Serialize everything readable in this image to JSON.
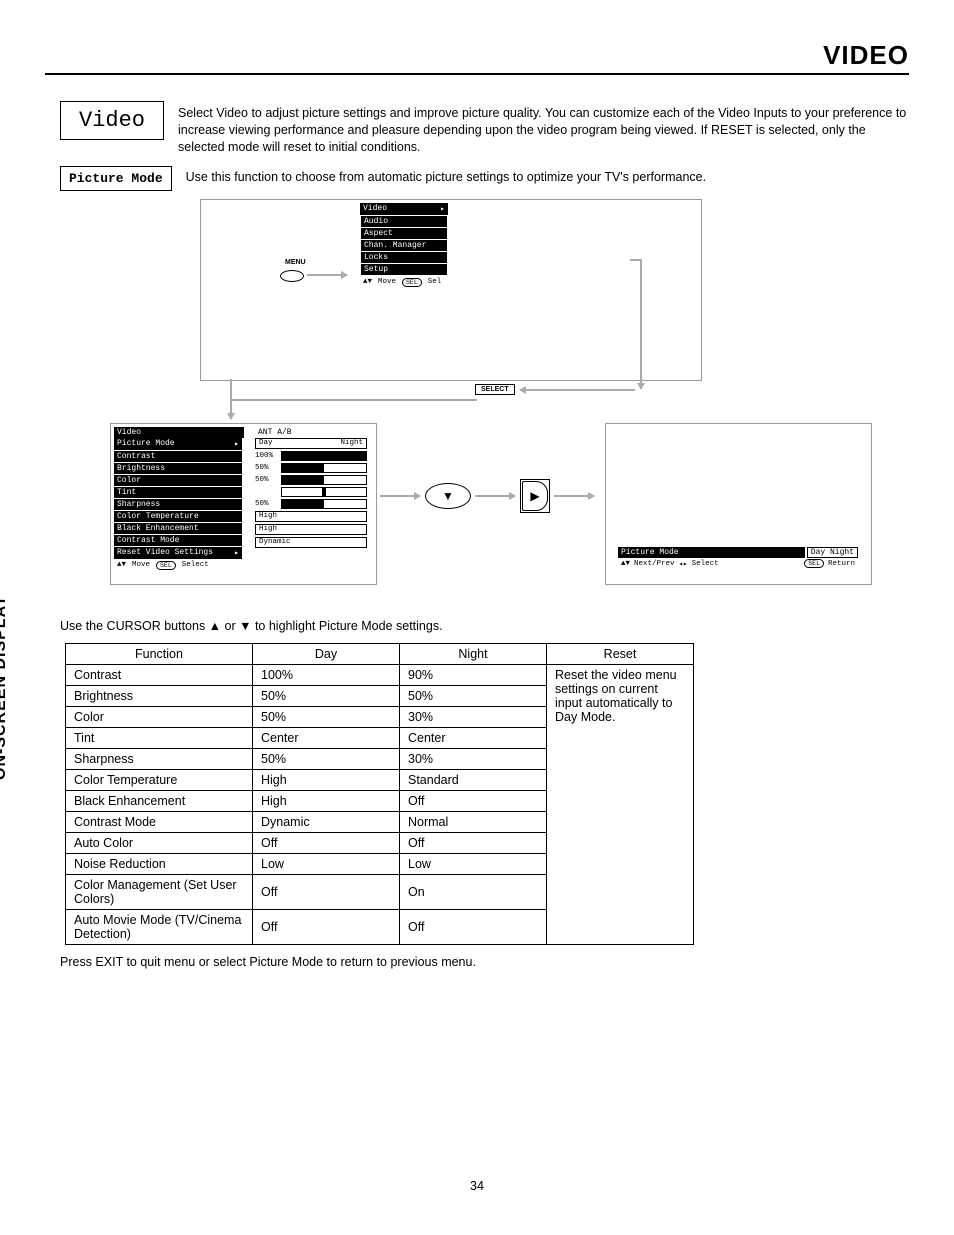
{
  "header": {
    "title": "VIDEO"
  },
  "sideLabel": "ON-SCREEN DISPLAY",
  "section": {
    "boxLabel": "Video",
    "intro": "Select Video to adjust picture settings and improve picture quality.  You can customize each of the Video Inputs to your preference to increase viewing performance and pleasure depending upon the video program being viewed.  If RESET is selected, only the selected mode will reset to initial conditions.",
    "pmBox": "Picture Mode",
    "pmText": "Use this function to choose from automatic picture settings to optimize your TV's performance."
  },
  "diagram": {
    "menuLabel": "MENU",
    "selectLabel": "SELECT",
    "mainMenu": {
      "title": "Video",
      "items": [
        "Audio",
        "Aspect",
        "Chan. Manager",
        "Locks",
        "Setup"
      ],
      "footer": "Move      Sel",
      "footerSel": "SEL"
    },
    "videoMenu": {
      "title": "Video",
      "items": [
        {
          "label": "Picture Mode",
          "hasArrow": true
        },
        {
          "label": "Contrast"
        },
        {
          "label": "Brightness"
        },
        {
          "label": "Color"
        },
        {
          "label": "Tint"
        },
        {
          "label": "Sharpness"
        },
        {
          "label": "Color Temperature"
        },
        {
          "label": "Black Enhancement"
        },
        {
          "label": "Contrast Mode"
        },
        {
          "label": "Reset Video Settings",
          "hasArrow": true
        }
      ],
      "footer": "Move     Select",
      "footerSel": "SEL"
    },
    "valuesPanel": {
      "header": "ANT A/B",
      "rows": [
        {
          "type": "text",
          "left": "Day",
          "right": "Night"
        },
        {
          "type": "bar",
          "label": "100%",
          "fill": 100
        },
        {
          "type": "bar",
          "label": "50%",
          "fill": 50,
          "dot": 75
        },
        {
          "type": "bar",
          "label": "50%",
          "fill": 50,
          "dot": 75
        },
        {
          "type": "center-dot"
        },
        {
          "type": "bar",
          "label": "50%",
          "fill": 50
        },
        {
          "type": "plain",
          "text": "High"
        },
        {
          "type": "plain",
          "text": "High"
        },
        {
          "type": "plain",
          "text": "Dynamic"
        }
      ]
    },
    "pmPanel": {
      "title": "Picture Mode",
      "opts": "Day  Night",
      "footerLeft": "Next/Prev    Select",
      "footerRight": "Return",
      "footerSel": "SEL"
    }
  },
  "instructions": {
    "cursor": "Use the CURSOR buttons ▲ or ▼ to highlight Picture Mode settings.",
    "exit": "Press EXIT to quit menu or select Picture Mode to return to previous menu."
  },
  "table": {
    "headers": [
      "Function",
      "Day",
      "Night",
      "Reset"
    ],
    "resetText": "Reset the video menu settings on current input automatically to Day Mode.",
    "rows": [
      [
        "Contrast",
        "100%",
        "90%"
      ],
      [
        "Brightness",
        "50%",
        "50%"
      ],
      [
        "Color",
        "50%",
        "30%"
      ],
      [
        "Tint",
        "Center",
        "Center"
      ],
      [
        "Sharpness",
        "50%",
        "30%"
      ],
      [
        "Color Temperature",
        "High",
        "Standard"
      ],
      [
        "Black Enhancement",
        "High",
        "Off"
      ],
      [
        "Contrast Mode",
        "Dynamic",
        "Normal"
      ],
      [
        "Auto Color",
        "Off",
        "Off"
      ],
      [
        "Noise Reduction",
        "Low",
        "Low"
      ],
      [
        "Color Management (Set User Colors)",
        "Off",
        "On"
      ],
      [
        "Auto Movie Mode (TV/Cinema Detection)",
        "Off",
        "Off"
      ]
    ]
  },
  "pageNum": "34"
}
